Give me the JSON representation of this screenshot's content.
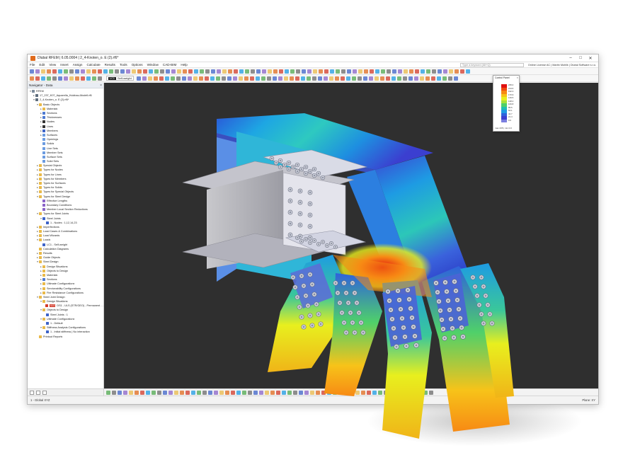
{
  "window": {
    "title": "Dlubal RFEM | 6.05.0004 | 2_4-Knoten_o. E (2).rf6*",
    "controls": [
      "–",
      "□",
      "✕"
    ]
  },
  "menu": [
    "File",
    "Edit",
    "View",
    "Insert",
    "Assign",
    "Calculate",
    "Results",
    "Tools",
    "Options",
    "Window",
    "CAD-BIM",
    "Help"
  ],
  "search_placeholder": "Type a keyword (Alt+Q)",
  "license": "Online License AC | Martin Mohlik | Dlubal Software s.r.o.",
  "loadcase": {
    "tag": "LC1",
    "label": "Self-weight"
  },
  "navigator": {
    "title": "Navigator - Data",
    "rows": [
      {
        "arrow": "▾",
        "indent": 0,
        "icon": "#7b8a9a",
        "label": "RFEM"
      },
      {
        "arrow": "▸",
        "indent": 1,
        "icon": "#5d6c7c",
        "label": "17_237_K07_Aquarella_Holzbau-Modell.rf6"
      },
      {
        "arrow": "▾",
        "indent": 1,
        "icon": "#5d6c7c",
        "label": "2_4-Knoten_o. E (2).rf6*"
      },
      {
        "arrow": "▾",
        "indent": 2,
        "icon": "#e9b949",
        "label": "Basic Objects"
      },
      {
        "arrow": "▸",
        "indent": 3,
        "icon": "#e9b949",
        "label": "Materials"
      },
      {
        "arrow": "▸",
        "indent": 3,
        "icon": "#4e7ad1",
        "label": "Sections"
      },
      {
        "arrow": "▸",
        "indent": 3,
        "icon": "#4e7ad1",
        "label": "Thicknesses"
      },
      {
        "arrow": "▸",
        "indent": 3,
        "icon": "#333333",
        "label": "Nodes"
      },
      {
        "arrow": "▸",
        "indent": 3,
        "icon": "#333333",
        "label": "Lines"
      },
      {
        "arrow": "▸",
        "indent": 3,
        "icon": "#3d63c8",
        "label": "Members"
      },
      {
        "arrow": "▸",
        "indent": 3,
        "icon": "#6b9be0",
        "label": "Surfaces"
      },
      {
        "arrow": "",
        "indent": 3,
        "icon": "#6b9be0",
        "label": "Openings"
      },
      {
        "arrow": "",
        "indent": 3,
        "icon": "#6b9be0",
        "label": "Solids"
      },
      {
        "arrow": "",
        "indent": 3,
        "icon": "#6b9be0",
        "label": "Line Sets"
      },
      {
        "arrow": "",
        "indent": 3,
        "icon": "#6b9be0",
        "label": "Member Sets"
      },
      {
        "arrow": "",
        "indent": 3,
        "icon": "#6b9be0",
        "label": "Surface Sets"
      },
      {
        "arrow": "",
        "indent": 3,
        "icon": "#6b9be0",
        "label": "Solid Sets"
      },
      {
        "arrow": "▸",
        "indent": 2,
        "icon": "#e9b949",
        "label": "Special Objects"
      },
      {
        "arrow": "▸",
        "indent": 2,
        "icon": "#e9b949",
        "label": "Types for Nodes"
      },
      {
        "arrow": "▸",
        "indent": 2,
        "icon": "#e9b949",
        "label": "Types for Lines"
      },
      {
        "arrow": "▸",
        "indent": 2,
        "icon": "#e9b949",
        "label": "Types for Members"
      },
      {
        "arrow": "▸",
        "indent": 2,
        "icon": "#e9b949",
        "label": "Types for Surfaces"
      },
      {
        "arrow": "▸",
        "indent": 2,
        "icon": "#e9b949",
        "label": "Types for Solids"
      },
      {
        "arrow": "▸",
        "indent": 2,
        "icon": "#e9b949",
        "label": "Types for Special Objects"
      },
      {
        "arrow": "▾",
        "indent": 2,
        "icon": "#e9b949",
        "label": "Types for Steel Design"
      },
      {
        "arrow": "",
        "indent": 3,
        "icon": "#8a63c8",
        "label": "Effective Lengths"
      },
      {
        "arrow": "",
        "indent": 3,
        "icon": "#8a63c8",
        "label": "Boundary Conditions"
      },
      {
        "arrow": "",
        "indent": 3,
        "icon": "#8a63c8",
        "label": "Member Local Section Reductions"
      },
      {
        "arrow": "▾",
        "indent": 2,
        "icon": "#e9b949",
        "label": "Types for Steel Joints"
      },
      {
        "arrow": "▾",
        "indent": 3,
        "icon": "#3d63c8",
        "label": "Steel Joints"
      },
      {
        "arrow": "",
        "indent": 4,
        "icon": "#3d63c8",
        "label": "1 - Nodes : 1,12,14,23"
      },
      {
        "arrow": "▸",
        "indent": 2,
        "icon": "#e9b949",
        "label": "Imperfections"
      },
      {
        "arrow": "▸",
        "indent": 2,
        "icon": "#e9b949",
        "label": "Load Cases & Combinations"
      },
      {
        "arrow": "▸",
        "indent": 2,
        "icon": "#e9b949",
        "label": "Load Wizards"
      },
      {
        "arrow": "▾",
        "indent": 2,
        "icon": "#e9b949",
        "label": "Loads"
      },
      {
        "arrow": "",
        "indent": 3,
        "icon": "#3d63c8",
        "label": "LC1 - Self-weight"
      },
      {
        "arrow": "",
        "indent": 2,
        "icon": "#e9b949",
        "label": "Calculation Diagrams"
      },
      {
        "arrow": "▸",
        "indent": 2,
        "icon": "#e9b949",
        "label": "Results"
      },
      {
        "arrow": "▸",
        "indent": 2,
        "icon": "#e9b949",
        "label": "Guide Objects"
      },
      {
        "arrow": "▾",
        "indent": 2,
        "icon": "#e9b949",
        "label": "Steel Design"
      },
      {
        "arrow": "▸",
        "indent": 3,
        "icon": "#e9b949",
        "label": "Design Situations"
      },
      {
        "arrow": "▸",
        "indent": 3,
        "icon": "#e9b949",
        "label": "Objects to Design"
      },
      {
        "arrow": "▸",
        "indent": 3,
        "icon": "#e9b949",
        "label": "Materials"
      },
      {
        "arrow": "▸",
        "indent": 3,
        "icon": "#4e7ad1",
        "label": "Sections"
      },
      {
        "arrow": "▸",
        "indent": 3,
        "icon": "#e9b949",
        "label": "Ultimate Configurations"
      },
      {
        "arrow": "▸",
        "indent": 3,
        "icon": "#e9b949",
        "label": "Serviceability Configurations"
      },
      {
        "arrow": "▸",
        "indent": 3,
        "icon": "#e9b949",
        "label": "Fire Resistance Configurations"
      },
      {
        "arrow": "▾",
        "indent": 2,
        "icon": "#e9b949",
        "label": "Steel Joint Design"
      },
      {
        "arrow": "▾",
        "indent": 3,
        "icon": "#e9b949",
        "label": "Design Situations"
      },
      {
        "arrow": "",
        "indent": 4,
        "icon": "#d23a2a",
        "label": "DS1 - ULS (STR/GEO) - Permanent and transient",
        "badge": "ULS"
      },
      {
        "arrow": "▾",
        "indent": 3,
        "icon": "#e9b949",
        "label": "Objects to Design"
      },
      {
        "arrow": "",
        "indent": 4,
        "icon": "#3d63c8",
        "label": "Steel Joints : 1"
      },
      {
        "arrow": "▾",
        "indent": 3,
        "icon": "#e9b949",
        "label": "Ultimate Configurations"
      },
      {
        "arrow": "",
        "indent": 4,
        "icon": "#3d63c8",
        "label": "1 - Default"
      },
      {
        "arrow": "▾",
        "indent": 3,
        "icon": "#e9b949",
        "label": "Stiffness Analysis Configurations"
      },
      {
        "arrow": "",
        "indent": 4,
        "icon": "#3d63c8",
        "label": "1 - Initial stiffness | No interaction"
      },
      {
        "arrow": "",
        "indent": 2,
        "icon": "#e9b949",
        "label": "Printout Reports"
      }
    ]
  },
  "status": {
    "coord_system": "1 - Global XYZ",
    "plane": "Plane: XY"
  },
  "legend": {
    "title": "Control Panel",
    "close": "×",
    "values": [
      "235.0",
      "213.6",
      "192.3",
      "170.9",
      "149.5",
      "128.2",
      "106.8",
      "85.5",
      "64.1",
      "42.7",
      "21.4",
      "0.0"
    ],
    "footer": "max 235 | min 0.0"
  },
  "colors": {
    "legend_scale": [
      "#e01010",
      "#f04a10",
      "#f78a14",
      "#f7c319",
      "#e8ef1e",
      "#a6e13a",
      "#4fd06a",
      "#20bfb0",
      "#1e9be3",
      "#2f62dc",
      "#3b3fd0",
      "#7a7ee0"
    ]
  },
  "icons": {
    "logo": "rfem-logo-icon",
    "close": "close-icon"
  }
}
